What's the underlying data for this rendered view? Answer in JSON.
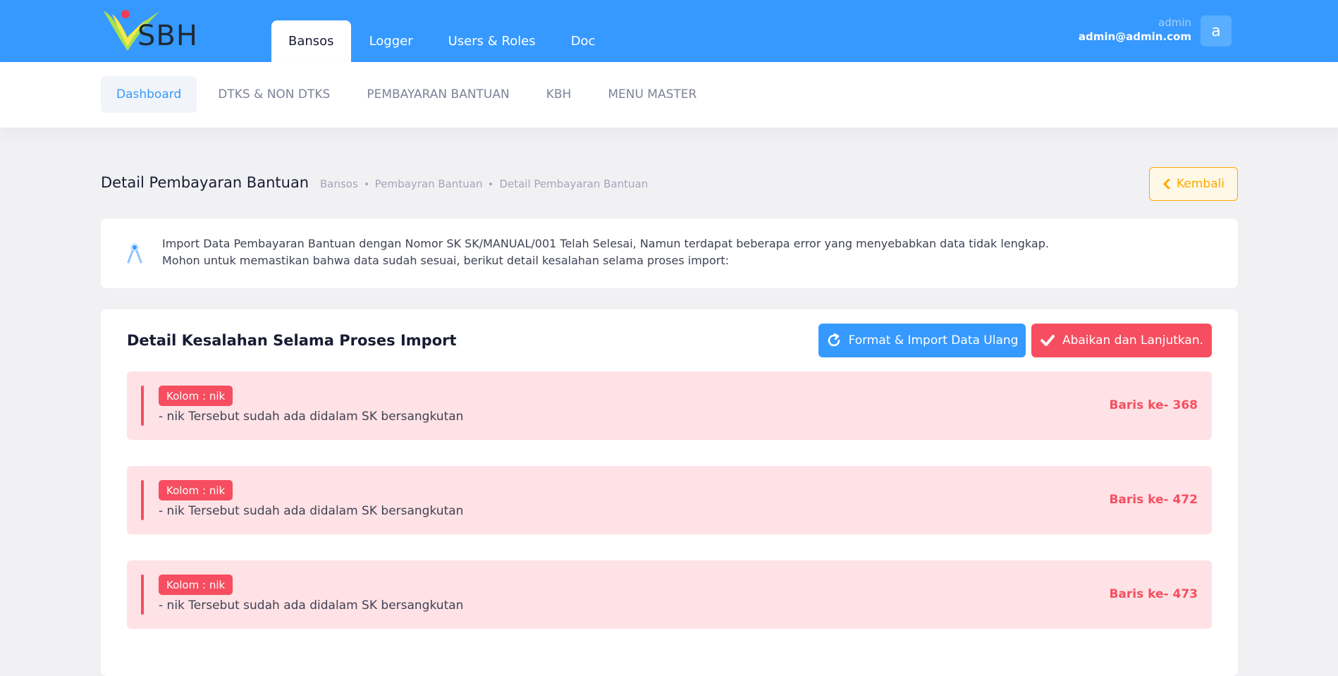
{
  "header": {
    "logo_text": "SBH",
    "tabs": [
      {
        "label": "Bansos",
        "active": true
      },
      {
        "label": "Logger",
        "active": false
      },
      {
        "label": "Users & Roles",
        "active": false
      },
      {
        "label": "Doc",
        "active": false
      }
    ],
    "user": {
      "name": "admin",
      "email": "admin@admin.com",
      "avatar_letter": "a"
    }
  },
  "subnav": {
    "items": [
      {
        "label": "Dashboard",
        "active": true
      },
      {
        "label": "DTKS & NON DTKS",
        "active": false
      },
      {
        "label": "PEMBAYARAN BANTUAN",
        "active": false
      },
      {
        "label": "KBH",
        "active": false
      },
      {
        "label": "MENU MASTER",
        "active": false
      }
    ]
  },
  "toolbar": {
    "title": "Detail Pembayaran Bantuan",
    "breadcrumb": [
      "Bansos",
      "Pembayran Bantuan",
      "Detail Pembayaran Bantuan"
    ],
    "back_label": "Kembali"
  },
  "notice": {
    "icon": "compass-icon",
    "line1": "Import Data Pembayaran Bantuan dengan Nomor SK SK/MANUAL/001 Telah Selesai, Namun terdapat beberapa error yang menyebabkan data tidak lengkap.",
    "line2": "Mohon untuk memastikan bahwa data sudah sesuai, berikut detail kesalahan selama proses import:"
  },
  "errors_card": {
    "title": "Detail Kesalahan Selama Proses Import",
    "reimport_label": "Format & Import Data Ulang",
    "ignore_label": "Abaikan dan Lanjutkan.",
    "items": [
      {
        "column": "Kolom : nik",
        "message": "- nik Tersebut sudah ada didalam SK bersangkutan",
        "row": "Baris ke- 368"
      },
      {
        "column": "Kolom : nik",
        "message": "- nik Tersebut sudah ada didalam SK bersangkutan",
        "row": "Baris ke- 472"
      },
      {
        "column": "Kolom : nik",
        "message": "- nik Tersebut sudah ada didalam SK bersangkutan",
        "row": "Baris ke- 473"
      }
    ]
  },
  "colors": {
    "primary": "#3699ff",
    "danger": "#f64e60",
    "danger_light": "#ffe2e5",
    "warning": "#ffa800",
    "background": "#f1f1f4"
  }
}
